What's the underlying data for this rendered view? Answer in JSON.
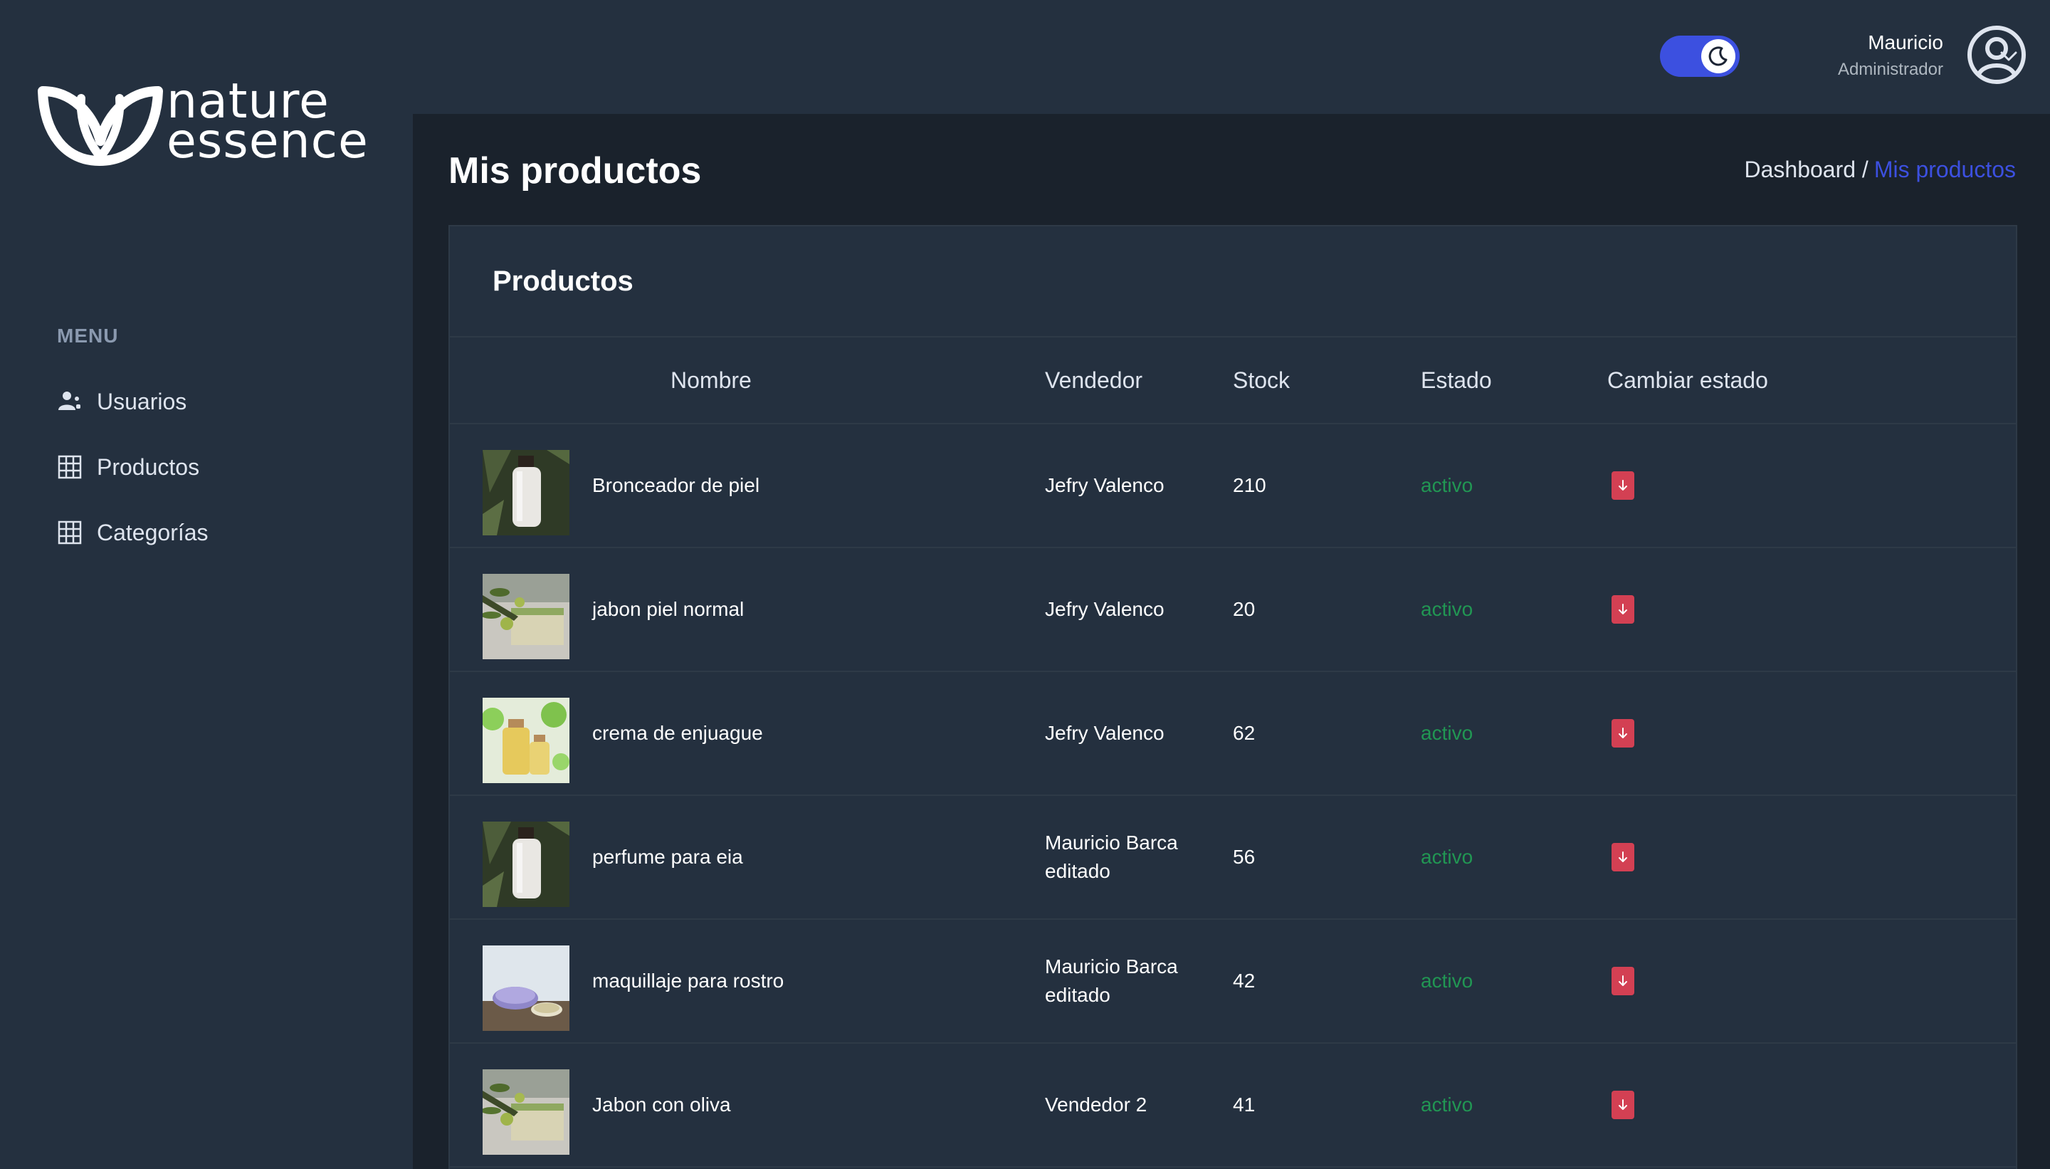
{
  "brand": {
    "line1": "nature",
    "line2": "essence"
  },
  "sidebar": {
    "menu_title": "MENU",
    "items": [
      {
        "label": "Usuarios",
        "icon": "users-icon"
      },
      {
        "label": "Productos",
        "icon": "table-icon"
      },
      {
        "label": "Categorías",
        "icon": "table-icon"
      }
    ]
  },
  "header": {
    "theme_toggle": {
      "state": "dark",
      "icon": "moon-icon"
    },
    "user": {
      "name": "Mauricio",
      "role": "Administrador"
    }
  },
  "page": {
    "title": "Mis productos",
    "breadcrumb": {
      "root": "Dashboard /",
      "current": "Mis productos"
    }
  },
  "card": {
    "title": "Productos",
    "columns": [
      "Nombre",
      "Vendedor",
      "Stock",
      "Estado",
      "Cambiar estado"
    ],
    "rows": [
      {
        "name": "Bronceador de piel",
        "seller_line1": "Jefry Valenco",
        "seller_line2": "",
        "stock": "210",
        "status": "activo",
        "thumb": "bottle"
      },
      {
        "name": "jabon piel normal",
        "seller_line1": "Jefry Valenco",
        "seller_line2": "",
        "stock": "20",
        "status": "activo",
        "thumb": "soap"
      },
      {
        "name": "crema de enjuague",
        "seller_line1": "Jefry Valenco",
        "seller_line2": "",
        "stock": "62",
        "status": "activo",
        "thumb": "oil"
      },
      {
        "name": "perfume para eia",
        "seller_line1": "Mauricio Barca",
        "seller_line2": "editado",
        "stock": "56",
        "status": "activo",
        "thumb": "bottle"
      },
      {
        "name": "maquillaje para rostro",
        "seller_line1": "Mauricio Barca",
        "seller_line2": "editado",
        "stock": "42",
        "status": "activo",
        "thumb": "tin"
      },
      {
        "name": "Jabon con oliva",
        "seller_line1": "Vendedor 2",
        "seller_line2": "",
        "stock": "41",
        "status": "activo",
        "thumb": "soap"
      }
    ]
  },
  "colors": {
    "primary": "#3c50e0",
    "success": "#219653",
    "danger": "#d34053",
    "bg_sidebar": "#24303f",
    "bg_main": "#1a222c"
  }
}
